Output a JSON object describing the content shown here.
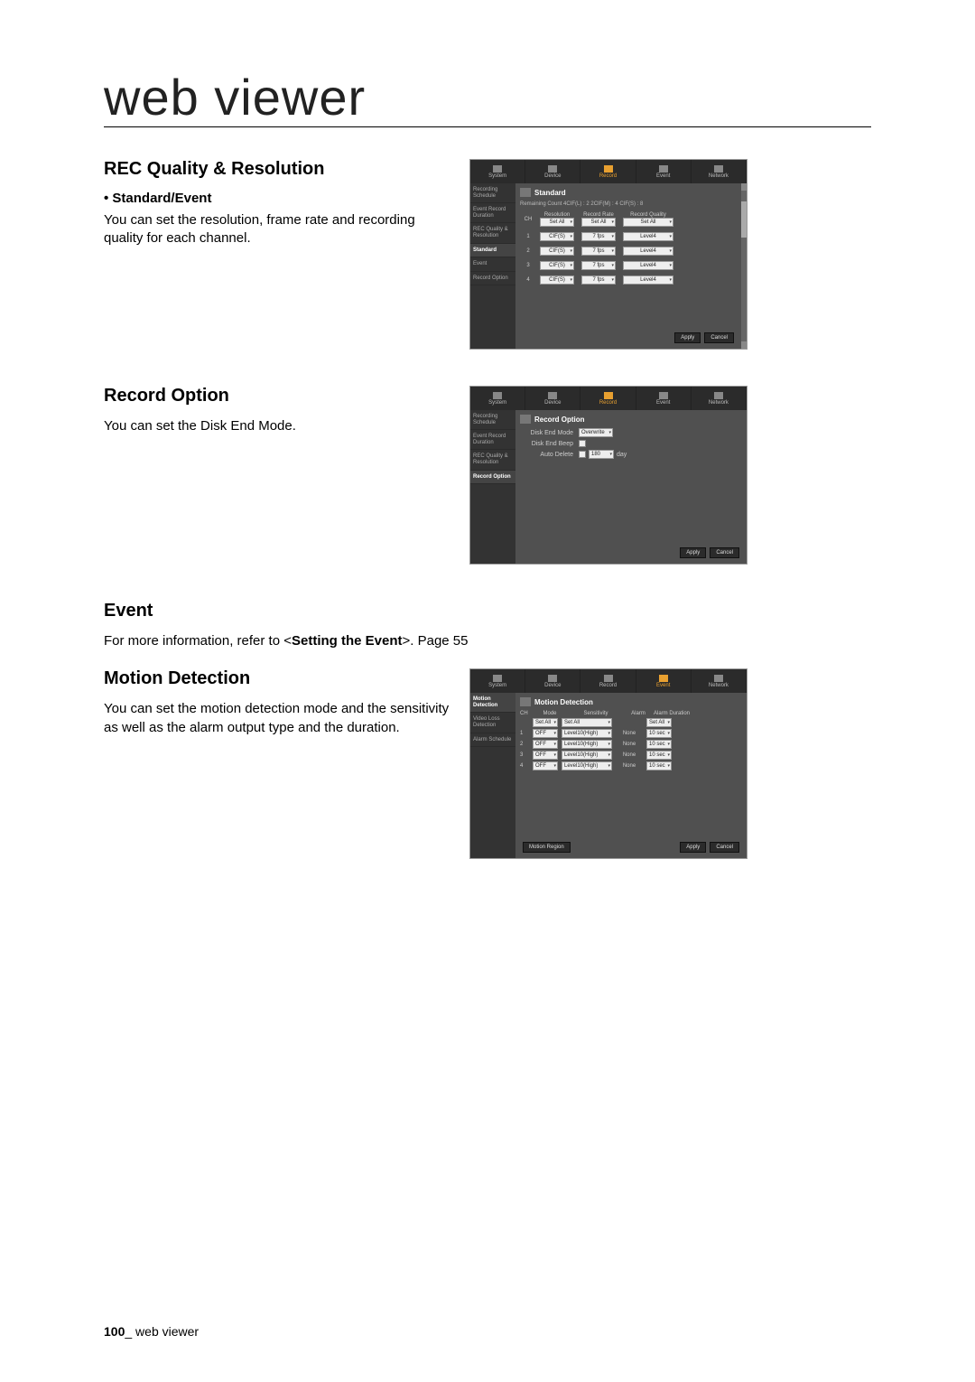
{
  "page_title": "web viewer",
  "page_number": "100",
  "page_footer_label": "web viewer",
  "section1": {
    "heading": "REC Quality & Resolution",
    "sub": "Standard/Event",
    "body": "You can set the resolution, frame rate and recording quality for each channel."
  },
  "section2": {
    "heading": "Record Option",
    "body": "You can set the Disk End Mode."
  },
  "section3": {
    "heading": "Event",
    "body_pre": "For more information, refer to <",
    "body_bold": "Setting the Event",
    "body_post": ">. Page 55"
  },
  "section4": {
    "heading": "Motion Detection",
    "body": "You can set the motion detection mode and the sensitivity as well as the alarm output type and the duration."
  },
  "tabs": [
    "System",
    "Device",
    "Record",
    "Event",
    "Network"
  ],
  "fig1": {
    "sidebar": [
      "Recording Schedule",
      "Event Record Duration",
      "REC Quality & Resolution",
      "Standard",
      "Event",
      "Record Option"
    ],
    "panel_title": "Standard",
    "remaining": "Remaining Count   4CIF(L) : 2       2CIF(M) : 4       CIF(S) : 8",
    "col_ch": "CH",
    "col_res": "Resolution",
    "col_rate": "Record Rate",
    "col_qual": "Record Quality",
    "set_all": "Set All",
    "rows": [
      {
        "ch": "1",
        "res": "CIF(S)",
        "rate": "7 fps",
        "qual": "Level4"
      },
      {
        "ch": "2",
        "res": "CIF(S)",
        "rate": "7 fps",
        "qual": "Level4"
      },
      {
        "ch": "3",
        "res": "CIF(S)",
        "rate": "7 fps",
        "qual": "Level4"
      },
      {
        "ch": "4",
        "res": "CIF(S)",
        "rate": "7 fps",
        "qual": "Level4"
      }
    ],
    "apply": "Apply",
    "cancel": "Cancel"
  },
  "fig2": {
    "sidebar": [
      "Recording Schedule",
      "Event Record Duration",
      "REC Quality & Resolution",
      "Record Option"
    ],
    "panel_title": "Record Option",
    "opt_dem": "Disk End Mode",
    "opt_dem_v": "Overwrite",
    "opt_beep": "Disk End Beep",
    "opt_auto": "Auto Delete",
    "opt_auto_v": "180",
    "opt_auto_u": "day",
    "apply": "Apply",
    "cancel": "Cancel"
  },
  "fig3": {
    "sidebar": [
      "Motion Detection",
      "Video Loss Detection",
      "Alarm Schedule"
    ],
    "panel_title": "Motion Detection",
    "hdr_ch": "CH",
    "hdr_mode": "Mode",
    "hdr_sens": "Sensitivity",
    "hdr_alarm": "Alarm",
    "hdr_dur": "Alarm Duration",
    "set_all": "Set All",
    "rows": [
      {
        "ch": "1",
        "mode": "OFF",
        "sens": "Level10(High)",
        "alarm": "None",
        "dur": "10 sec"
      },
      {
        "ch": "2",
        "mode": "OFF",
        "sens": "Level10(High)",
        "alarm": "None",
        "dur": "10 sec"
      },
      {
        "ch": "3",
        "mode": "OFF",
        "sens": "Level10(High)",
        "alarm": "None",
        "dur": "10 sec"
      },
      {
        "ch": "4",
        "mode": "OFF",
        "sens": "Level10(High)",
        "alarm": "None",
        "dur": "10 sec"
      }
    ],
    "motion_region": "Motion Region",
    "apply": "Apply",
    "cancel": "Cancel"
  }
}
